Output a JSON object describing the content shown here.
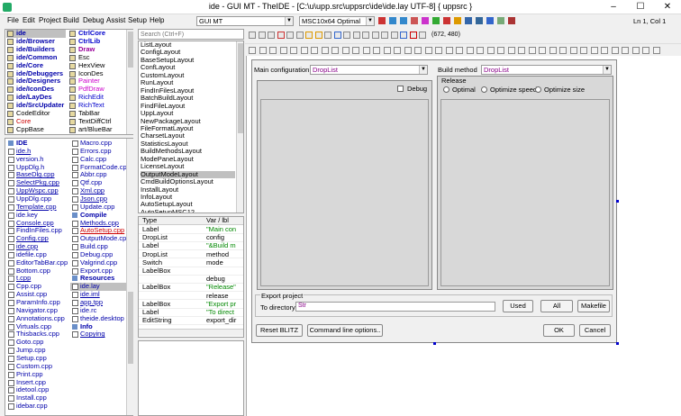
{
  "window": {
    "title": "ide - GUI MT - TheIDE - [C:\\u\\upp.src\\uppsrc\\ide\\ide.lay UTF-8] { uppsrc }",
    "min": "–",
    "max": "☐",
    "close": "✕"
  },
  "menu": [
    "File",
    "Edit",
    "Project",
    "Build",
    "Debug",
    "Assist",
    "Setup",
    "Help"
  ],
  "toolbar": {
    "config_combo": "GUI MT",
    "method_combo": "MSC10x64 Optimal",
    "position": "Ln 1, Col 1",
    "coords": "(672, 480)"
  },
  "packages": [
    {
      "name": "ide",
      "style": "bold",
      "selected": true
    },
    {
      "name": "ide/Browser",
      "style": "bold"
    },
    {
      "name": "ide/Builders",
      "style": "bold"
    },
    {
      "name": "ide/Common",
      "style": "bold"
    },
    {
      "name": "ide/Core",
      "style": "bold"
    },
    {
      "name": "ide/Debuggers",
      "style": "bold"
    },
    {
      "name": "ide/Designers",
      "style": "bold"
    },
    {
      "name": "ide/IconDes",
      "style": "bold"
    },
    {
      "name": "ide/LayDes",
      "style": "bold"
    },
    {
      "name": "ide/SrcUpdater",
      "style": "bold"
    },
    {
      "name": "CodeEditor",
      "style": "normal"
    },
    {
      "name": "Core",
      "style": "red"
    },
    {
      "name": "CppBase",
      "style": "normal"
    }
  ],
  "packages2": [
    {
      "name": "CtrlCore",
      "style": "blue-bold"
    },
    {
      "name": "CtrlLib",
      "style": "blue-bold"
    },
    {
      "name": "Draw",
      "style": "purple-bold"
    },
    {
      "name": "Esc",
      "style": "normal"
    },
    {
      "name": "HexView",
      "style": "normal"
    },
    {
      "name": "IconDes",
      "style": "normal"
    },
    {
      "name": "Painter",
      "style": "purple"
    },
    {
      "name": "PdfDraw",
      "style": "purple"
    },
    {
      "name": "RichEdit",
      "style": "blue"
    },
    {
      "name": "RichText",
      "style": "blue"
    },
    {
      "name": "TabBar",
      "style": "normal"
    },
    {
      "name": "TextDiffCtrl",
      "style": "normal"
    },
    {
      "name": "art/BlueBar",
      "style": "normal"
    }
  ],
  "files1": [
    {
      "name": "IDE",
      "hdr": true
    },
    {
      "name": "ide.h",
      "u": true
    },
    {
      "name": "version.h"
    },
    {
      "name": "UppDlg.h"
    },
    {
      "name": "BaseDlg.cpp",
      "u": true
    },
    {
      "name": "SelectPkg.cpp",
      "u": true
    },
    {
      "name": "UppWspc.cpp",
      "u": true
    },
    {
      "name": "UppDlg.cpp"
    },
    {
      "name": "Template.cpp",
      "u": true
    },
    {
      "name": "ide.key"
    },
    {
      "name": "Console.cpp",
      "u": true
    },
    {
      "name": "FindInFiles.cpp"
    },
    {
      "name": "Config.cpp",
      "u": true
    },
    {
      "name": "ide.cpp",
      "u": true
    },
    {
      "name": "idefile.cpp"
    },
    {
      "name": "EditorTabBar.cpp"
    },
    {
      "name": "Bottom.cpp"
    },
    {
      "name": "t.cpp",
      "u": true
    },
    {
      "name": "Cpp.cpp"
    },
    {
      "name": "Assist.cpp"
    },
    {
      "name": "ParamInfo.cpp"
    },
    {
      "name": "Navigator.cpp"
    },
    {
      "name": "Annotations.cpp"
    },
    {
      "name": "Virtuals.cpp"
    },
    {
      "name": "Thisbacks.cpp"
    },
    {
      "name": "Goto.cpp"
    },
    {
      "name": "Jump.cpp"
    },
    {
      "name": "Setup.cpp"
    },
    {
      "name": "Custom.cpp"
    },
    {
      "name": "Print.cpp"
    },
    {
      "name": "Insert.cpp"
    },
    {
      "name": "idetool.cpp"
    },
    {
      "name": "Install.cpp"
    },
    {
      "name": "idebar.cpp"
    }
  ],
  "files2": [
    {
      "name": "Macro.cpp"
    },
    {
      "name": "Errors.cpp"
    },
    {
      "name": "Calc.cpp"
    },
    {
      "name": "FormatCode.cpp"
    },
    {
      "name": "Abbr.cpp"
    },
    {
      "name": "Qtf.cpp"
    },
    {
      "name": "Xml.cpp",
      "u": true
    },
    {
      "name": "Json.cpp",
      "u": true
    },
    {
      "name": "Update.cpp"
    },
    {
      "name": "Compile",
      "hdr": true
    },
    {
      "name": "Methods.cpp",
      "u": true
    },
    {
      "name": "AutoSetup.cpp",
      "u": true,
      "red": true
    },
    {
      "name": "OutputMode.cpp"
    },
    {
      "name": "Build.cpp"
    },
    {
      "name": "Debug.cpp"
    },
    {
      "name": "Valgrind.cpp"
    },
    {
      "name": "Export.cpp"
    },
    {
      "name": "Resources",
      "hdr": true
    },
    {
      "name": "ide.lay",
      "sel": true
    },
    {
      "name": "ide.iml",
      "u": true
    },
    {
      "name": "app.tpp",
      "u": true
    },
    {
      "name": "ide.rc"
    },
    {
      "name": "theide.desktop"
    },
    {
      "name": "Info",
      "hdr": true
    },
    {
      "name": "Copying",
      "u": true
    }
  ],
  "search_placeholder": "Search (Ctrl+F)",
  "layouts": [
    "ListLayout",
    "ConfigLayout",
    "BaseSetupLayout",
    "ConfLayout",
    "CustomLayout",
    "RunLayout",
    "FindInFilesLayout",
    "BatchBuildLayout",
    "FindFileLayout",
    "UppLayout",
    "NewPackageLayout",
    "FileFormatLayout",
    "CharsetLayout",
    "StatisticsLayout",
    "BuildMethodsLayout",
    "ModePaneLayout",
    "LicenseLayout",
    "OutputModeLayout",
    "CmdBuildOptionsLayout",
    "InstallLayout",
    "InfoLayout",
    "AutoSetupLayout",
    "AutoSetupMSC12"
  ],
  "layouts_selected": 17,
  "props_header": {
    "type": "Type",
    "var": "Var / lbl"
  },
  "props": [
    {
      "type": "Label",
      "var": "\"Main con"
    },
    {
      "type": "DropList",
      "var": "config"
    },
    {
      "type": "Label",
      "var": "\"&Build m"
    },
    {
      "type": "DropList",
      "var": "method"
    },
    {
      "type": "Switch",
      "var": "mode"
    },
    {
      "type": "LabelBox",
      "var": ""
    },
    {
      "type": "",
      "var": "debug"
    },
    {
      "type": "LabelBox",
      "var": "\"Release\""
    },
    {
      "type": "",
      "var": "release"
    },
    {
      "type": "LabelBox",
      "var": "\"Export pr"
    },
    {
      "type": "Label",
      "var": "\"To direct"
    },
    {
      "type": "EditString",
      "var": "export_dir"
    }
  ],
  "dialog": {
    "main_config_label": "Main configuration",
    "main_config_value": "DropList",
    "build_method_label": "Build method",
    "build_method_value": "DropList",
    "debug": "Debug",
    "release_group": "Release",
    "optimal": "Optimal",
    "optimize_speed": "Optimize speed",
    "optimize_size": "Optimize size",
    "export_group": "Export project",
    "to_directory": "To directory",
    "dir_value": "Str",
    "used": "Used",
    "all": "All",
    "makefile": "Makefile",
    "reset_blitz": "Reset BLITZ",
    "cmdline_opts": "Command line options..",
    "ok": "OK",
    "cancel": "Cancel"
  }
}
